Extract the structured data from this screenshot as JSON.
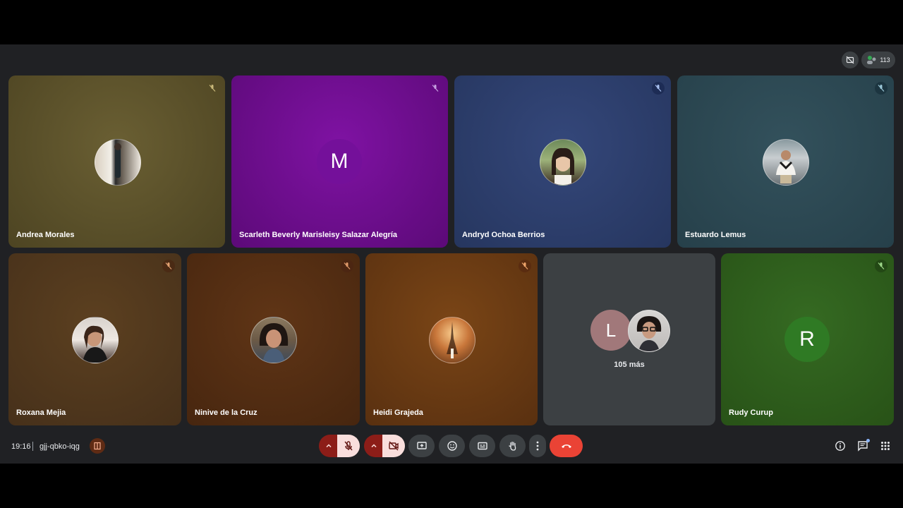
{
  "tiles_row1": [
    {
      "name": "Andrea Morales",
      "bg": "#5a5027"
    },
    {
      "name": "Scarleth Beverly Marisleisy Salazar Alegría",
      "bg": "#6b0d8a",
      "initial": "M"
    },
    {
      "name": "Andryd Ochoa Berrios",
      "bg": "#2d3f6f"
    },
    {
      "name": "Estuardo Lemus",
      "bg": "#2b4550"
    }
  ],
  "tiles_row2": [
    {
      "name": "Roxana Mejia",
      "bg": "#4f3618"
    },
    {
      "name": "Ninive de la Cruz",
      "bg": "#532c12"
    },
    {
      "name": "Heidi Grajeda",
      "bg": "#6b3b12"
    },
    {
      "more_initial": "L",
      "more_text": "105 más",
      "bg": "#3c4043"
    },
    {
      "name": "Rudy Curup",
      "bg": "#2e5e1c",
      "initial": "R"
    }
  ],
  "top": {
    "participant_count": "113"
  },
  "bottom": {
    "time": "19:16",
    "meeting_code": "gjj-qbko-iqg"
  },
  "icons": {
    "mic_off": "mic-off-icon",
    "camera_off": "camera-off-icon",
    "present": "present-screen-icon",
    "emoji": "emoji-icon",
    "captions": "captions-icon",
    "hand": "raise-hand-icon",
    "more": "more-options-icon",
    "end": "end-call-icon",
    "info": "info-icon",
    "chat": "chat-icon",
    "activities": "activities-icon"
  },
  "colors": {
    "end_call": "#ea4335",
    "mic_off_bg": "#f9dedc",
    "caret_bg": "#8c1d18"
  }
}
